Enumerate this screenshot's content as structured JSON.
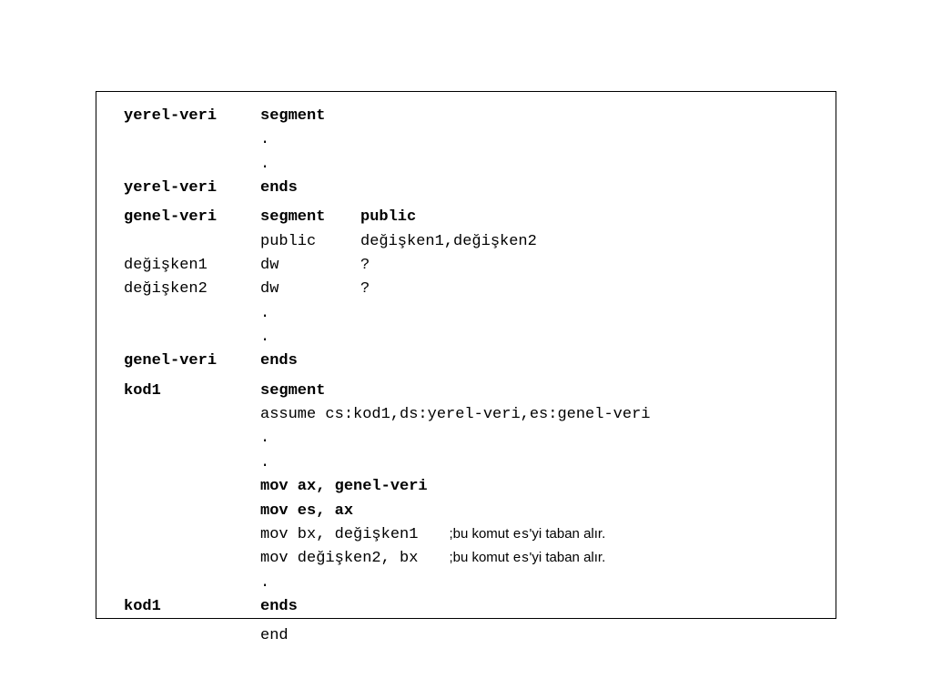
{
  "rows": [
    {
      "a": "yerel-veri",
      "a_bold": true,
      "b": "segment",
      "b_bold": true
    },
    {
      "a": "",
      "b": ".",
      "b_bold": false
    },
    {
      "a": "",
      "b": ".",
      "b_bold": false
    },
    {
      "a": "yerel-veri",
      "a_bold": true,
      "b": "ends",
      "b_bold": true
    },
    {
      "spacer": true
    },
    {
      "a": "genel-veri",
      "a_bold": true,
      "b": "segment",
      "b_bold": true,
      "c": "public",
      "c_bold": true
    },
    {
      "a": "",
      "b": "public",
      "b_bold": false,
      "c": "değişken1,değişken2"
    },
    {
      "a": "değişken1",
      "a_bold": false,
      "b": "dw",
      "c": "?"
    },
    {
      "a": "değişken2",
      "a_bold": false,
      "b": "dw",
      "c": "?"
    },
    {
      "a": "",
      "b": "."
    },
    {
      "a": "",
      "b": "."
    },
    {
      "a": "genel-veri",
      "a_bold": true,
      "b": "ends",
      "b_bold": true
    },
    {
      "spacer": true
    },
    {
      "a": "kod1",
      "a_bold": true,
      "b": "segment",
      "b_bold": true
    },
    {
      "a": "",
      "rest": "assume cs:kod1,ds:yerel-veri,es:genel-veri"
    },
    {
      "a": "",
      "b": "."
    },
    {
      "a": "",
      "b": "."
    },
    {
      "a": "",
      "rest": "mov ax, genel-veri",
      "rest_bold": true
    },
    {
      "a": "",
      "rest": "mov es, ax",
      "rest_bold": true
    },
    {
      "a": "",
      "rest": "mov bx, değişken1",
      "comment": ";bu komut ",
      "comment_mono": "es",
      "comment_tail": "'yi taban alır."
    },
    {
      "a": "",
      "rest": "mov değişken2, bx",
      "comment": ";bu komut ",
      "comment_mono": "es",
      "comment_tail": "'yi taban alır."
    },
    {
      "a": "",
      "b": "."
    },
    {
      "a": "kod1",
      "a_bold": true,
      "b": "ends",
      "b_bold": true
    },
    {
      "spacer": true
    },
    {
      "a": "",
      "b": "end"
    }
  ]
}
